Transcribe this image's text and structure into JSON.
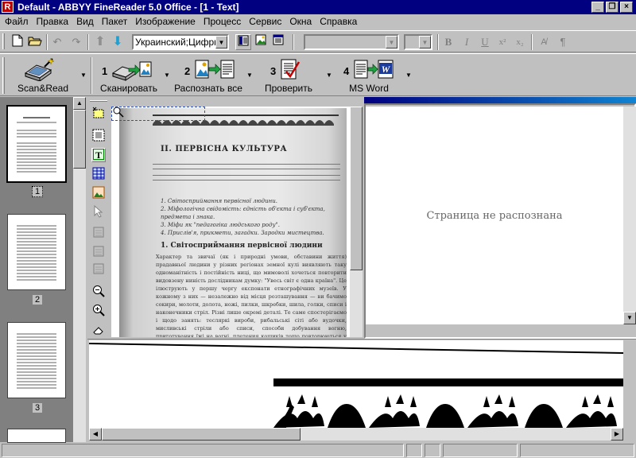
{
  "window": {
    "title": "Default - ABBYY FineReader 5.0 Office - [1 - Text]",
    "logo_letter": "R",
    "controls": [
      "_",
      "❐",
      "×"
    ]
  },
  "menu": [
    "Файл",
    "Правка",
    "Вид",
    "Пакет",
    "Изображение",
    "Процесс",
    "Сервис",
    "Окна",
    "Справка"
  ],
  "toolbar": {
    "language_combo": "Украинский;Цифры",
    "font_combo": "",
    "size_combo": ""
  },
  "steps": [
    {
      "label": "Scan&Read",
      "num": ""
    },
    {
      "label": "Сканировать",
      "num": "1"
    },
    {
      "label": "Распознать все",
      "num": "2"
    },
    {
      "label": "Проверить",
      "num": "3"
    },
    {
      "label": "MS Word",
      "num": "4"
    }
  ],
  "thumbnails": [
    {
      "num": "1"
    },
    {
      "num": "2"
    },
    {
      "num": "3"
    }
  ],
  "image_page": {
    "title": "II. ПЕРВІСНА КУЛЬТУРА",
    "list": [
      "1. Світосприймання первісної людини.",
      "2. Міфологічна свідомість: єдність об'єкта і суб'єкта, предмета і знака.",
      "3. Міфи як \"педагогіка людського роду\".",
      "4. Прислів'я, прикмети, загадки. Зародки мистецтва."
    ],
    "section_heading": "1. Світосприймання первісної людини",
    "body": "Характер та звичаї (як і природні умови, обставини життя) прадавньої людини у різних регіонах земної кулі виявляють таку одноманітність і постійність ницi, що мимоволі хочеться повторити видовзену нинiсть дослідникам думку: \"Увесь світ є одна країна\". Це ілюструють у першу чергу експонати етнографічних музеїв. У кожному з них — незалежно від місця розташування — ви бачимо сокири, молоти, долота, ножі, пилки, шкребки, шила, голки, списи і наконечники стріл. Різні лише окремі деталі. Те саме спостерігаємо і щодо занять: тесляркі вироби, рибальські сіті або вудочки, мисливські стріли або списи, способи добування вогню, приготування їжі на вогні, плетения кошиків тощо повторюються у всіх колекціях, які ілюструють побут віддалених суспільств від Камчатки до Вогняної Землі."
  },
  "text_pane": {
    "message": "Страница не распознана"
  },
  "colors": {
    "titlebar": "#000080",
    "face": "#c0c0c0",
    "pane_bg": "#808080",
    "accent_header": "#0000a8"
  }
}
